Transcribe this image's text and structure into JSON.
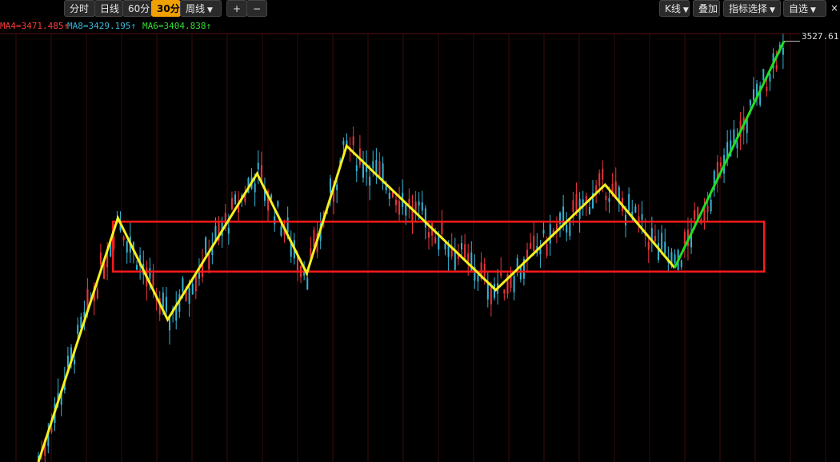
{
  "toolbar": {
    "period_tabs": [
      {
        "label": "分时",
        "active": false
      },
      {
        "label": "日线",
        "active": false
      },
      {
        "label": "60分",
        "active": false
      },
      {
        "label": "30分",
        "active": true
      },
      {
        "label": "周线",
        "active": false
      }
    ],
    "plus_label": "+",
    "minus_label": "−",
    "right_buttons": [
      "K线",
      "叠加",
      "指标选择",
      "自选"
    ],
    "close_label": "×"
  },
  "ma_readouts": [
    {
      "text": "MA4=3471.485↑",
      "color": "#ff3b3b"
    },
    {
      "text": "MA8=3429.195↑",
      "color": "#3bb7d6"
    },
    {
      "text": "MA6=3404.838↑",
      "color": "#33dd33"
    }
  ],
  "price_label": "3527.61",
  "colors": {
    "up_candle": "#e8353a",
    "down_candle": "#36b3d4",
    "zigzag": "#f5f01e",
    "breakout": "#22dd22",
    "box": "#ff1a1a",
    "grid": "#3a0a0a"
  },
  "chart_data": {
    "type": "line",
    "x_label": "",
    "y_label": "",
    "ylim": [
      3300,
      3530
    ],
    "zigzag_x": [
      0,
      8,
      13,
      22,
      27,
      31,
      46,
      57,
      64
    ],
    "zigzag_y": [
      3300,
      3432,
      3377,
      3456,
      3402,
      3471,
      3393,
      3450,
      3405
    ],
    "breakout_x": [
      64,
      75
    ],
    "breakout_y": [
      3405,
      3527.61
    ],
    "box_x": [
      7.5,
      73
    ],
    "box_y": [
      3403,
      3430
    ],
    "candles_x_max": 75
  }
}
